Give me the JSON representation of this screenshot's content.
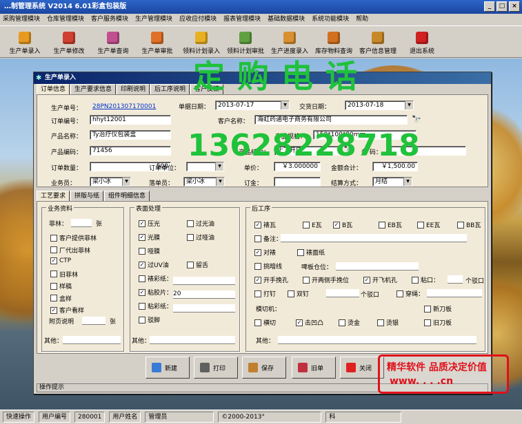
{
  "app": {
    "title": "…制管理系统  V2014  6.01彩盒包装版"
  },
  "titlebar_buttons": [
    "_",
    "□",
    "×"
  ],
  "menu": [
    "采购管理模块",
    "仓库管理模块",
    "客户服务模块",
    "生产管理模块",
    "应收应付模块",
    "报表管理模块",
    "基础数据模块",
    "系统功能模块",
    "帮助"
  ],
  "toolbar": [
    {
      "label": "生产单录入",
      "icon": "form-entry-icon",
      "color": "#e89a20"
    },
    {
      "label": "生产单修改",
      "icon": "form-edit-icon",
      "color": "#d04030"
    },
    {
      "label": "生产单查询",
      "icon": "search-icon",
      "color": "#c05090"
    },
    {
      "label": "生产单审批",
      "icon": "approve-icon",
      "color": "#e07028"
    },
    {
      "label": "领料计划录入",
      "icon": "material-entry-icon",
      "color": "#e8b020"
    },
    {
      "label": "领料计划审批",
      "icon": "material-approve-icon",
      "color": "#60a040"
    },
    {
      "label": "生产进度录入",
      "icon": "progress-icon",
      "color": "#d89030"
    },
    {
      "label": "库存物料查询",
      "icon": "inventory-icon",
      "color": "#d07020"
    },
    {
      "label": "客户信息管理",
      "icon": "customer-icon",
      "color": "#c88828"
    },
    {
      "label": "退出系统",
      "icon": "exit-icon",
      "color": "#d02020"
    }
  ],
  "form": {
    "title": "生产单录入",
    "tabs": [
      "订单信息",
      "生产要求信息",
      "印刷说明",
      "后工序说明",
      "客户反馈"
    ],
    "fields": {
      "prod_no_label": "生产单号：",
      "prod_no": "28PN201307170001",
      "date_label": "单据日期：",
      "date": "2013-07-17",
      "deliver_label": "交货日期：",
      "deliver": "2013-07-18",
      "order_no_label": "订单编号：",
      "order_no": "hhyt12001",
      "cust_label": "客户名称：",
      "cust": "海虹药通电子商务有限公司",
      "pname_label": "产品名称：",
      "pname": "Ty治疗仪包装盒",
      "spec_label": "产品规格：",
      "spec": "150*100*80mm",
      "pcode_label": "产品编码：",
      "pcode": "71456",
      "struct_label": "产品结构：",
      "struct": "上下开口",
      "barcode_label": "条  码：",
      "barcode": "",
      "qty_label": "订单数量：",
      "qty": "500",
      "unit_label": "订单单位：",
      "unit": "",
      "price_label": "单价：",
      "price": "￥3.000000",
      "total_label": "金额合计：",
      "total": "￥1,500.00",
      "sales_label": "业务员：",
      "sales": "梁小冰",
      "clerk_label": "落单员：",
      "clerk": "梁小冰",
      "deposit_label": "订金：",
      "deposit": "",
      "pay_label": "结算方式：",
      "pay": "月结"
    },
    "sub_tabs": [
      "工艺要求",
      "拼版与纸",
      "组件明细信息"
    ],
    "biz": {
      "title": "业务资料",
      "film_label": "菲林：",
      "film_unit": "张",
      "items": [
        {
          "label": "客户提供菲林",
          "checked": false
        },
        {
          "label": "厂代出菲林",
          "checked": false
        },
        {
          "label": "CTP",
          "checked": true
        },
        {
          "label": "旧菲林",
          "checked": false
        },
        {
          "label": "样稿",
          "checked": false
        },
        {
          "label": "盒样",
          "checked": false
        },
        {
          "label": "客户看样",
          "checked": true
        }
      ],
      "page_label": "附页说明",
      "page_unit": "张",
      "other_label": "其他："
    },
    "surface": {
      "title": "表面处理",
      "left": [
        {
          "label": "压光",
          "checked": true
        },
        {
          "label": "光膜",
          "checked": true
        },
        {
          "label": "哑膜",
          "checked": false
        },
        {
          "label": "过UV油",
          "checked": true
        },
        {
          "label": "裱彩纸：",
          "checked": false
        },
        {
          "label": "粘胶片：",
          "checked": true
        },
        {
          "label": "粘彩纸：",
          "checked": false
        },
        {
          "label": "驳脚",
          "checked": false
        }
      ],
      "right": [
        {
          "label": "过光油",
          "checked": false
        },
        {
          "label": "过哑油",
          "checked": false
        },
        {
          "label": "留舌",
          "checked": false
        }
      ],
      "glue_value": "20",
      "other_label": "其他："
    },
    "post": {
      "title": "后工序",
      "row1": [
        {
          "label": "裱瓦",
          "checked": true
        },
        {
          "label": "E瓦",
          "checked": false
        },
        {
          "label": "B瓦",
          "checked": true
        },
        {
          "label": "EB瓦",
          "checked": false
        },
        {
          "label": "EE瓦",
          "checked": false
        },
        {
          "label": "BB瓦",
          "checked": false
        }
      ],
      "note_label": "备注：",
      "row3": [
        {
          "label": "对裱",
          "checked": true
        },
        {
          "label": "裱面纸",
          "checked": false
        }
      ],
      "row4_label": "挑暗线",
      "row4_checked": false,
      "cut_label": "啤板仓位：",
      "row5": [
        {
          "label": "开手挽孔",
          "checked": true
        },
        {
          "label": "开两侧手挽位",
          "checked": false
        },
        {
          "label": "开飞机孔",
          "checked": true
        },
        {
          "label": "粘口：",
          "checked": false
        }
      ],
      "glue_unit": "个驳口",
      "row6": [
        {
          "label": "打钉",
          "checked": false
        },
        {
          "label": "双钉",
          "checked": false
        },
        {
          "label": "穿绳：",
          "checked": false
        }
      ],
      "nail_unit": "个驳口",
      "die_label": "模切机：",
      "row7": [
        {
          "label": "横切",
          "checked": false
        },
        {
          "label": "击凹凸",
          "checked": true
        },
        {
          "label": "烫金",
          "checked": false
        },
        {
          "label": "烫银",
          "checked": false
        }
      ],
      "knife": [
        {
          "label": "新刀板",
          "checked": false
        },
        {
          "label": "旧刀板",
          "checked": false
        }
      ],
      "other_label": "其他："
    },
    "buttons": [
      {
        "label": "新建",
        "icon": "new-icon",
        "color": "#3a7bd5"
      },
      {
        "label": "打印",
        "icon": "printer-icon",
        "color": "#606060"
      },
      {
        "label": "保存",
        "icon": "save-icon",
        "color": "#c08030"
      },
      {
        "label": "旧单",
        "icon": "old-form-icon",
        "color": "#c03040"
      },
      {
        "label": "关闭",
        "icon": "close-icon",
        "color": "#e02020"
      }
    ],
    "hint": "操作提示"
  },
  "status": {
    "quick": "快速操作",
    "uid_label": "用户编号",
    "uid": "280001",
    "uname_label": "用户姓名",
    "uname": "管理员",
    "copyright": "©2000-2013°",
    "extra": "科"
  },
  "watermark": {
    "chars": "定购电话",
    "phone": "13628228718",
    "color": "#1fc23a"
  },
  "promo": {
    "line1": "精华软件 品质决定价值",
    "line2": "www.  .  .  .cn",
    "color": "#e0101a"
  }
}
